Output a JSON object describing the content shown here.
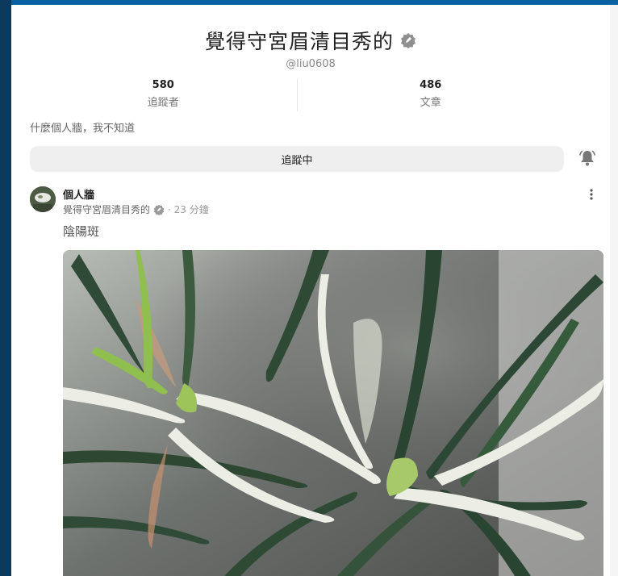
{
  "profile": {
    "name": "覺得守宮眉清目秀的",
    "handle": "@liu0608",
    "stats": [
      {
        "value": "580",
        "label": "追蹤者"
      },
      {
        "value": "486",
        "label": "文章"
      }
    ],
    "bio": "什麼個人牆，我不知道",
    "follow_label": "追蹤中"
  },
  "post": {
    "title": "個人牆",
    "author": "覺得守宮眉清目秀的",
    "time": "· 23 分鐘",
    "text": "陰陽斑"
  },
  "colors": {
    "topbar": "#0b62a3",
    "leftbar": "#0b3a5c",
    "button_bg": "#efefef"
  },
  "icons": [
    "verified-badge-icon",
    "bell-icon",
    "more-options-icon"
  ]
}
